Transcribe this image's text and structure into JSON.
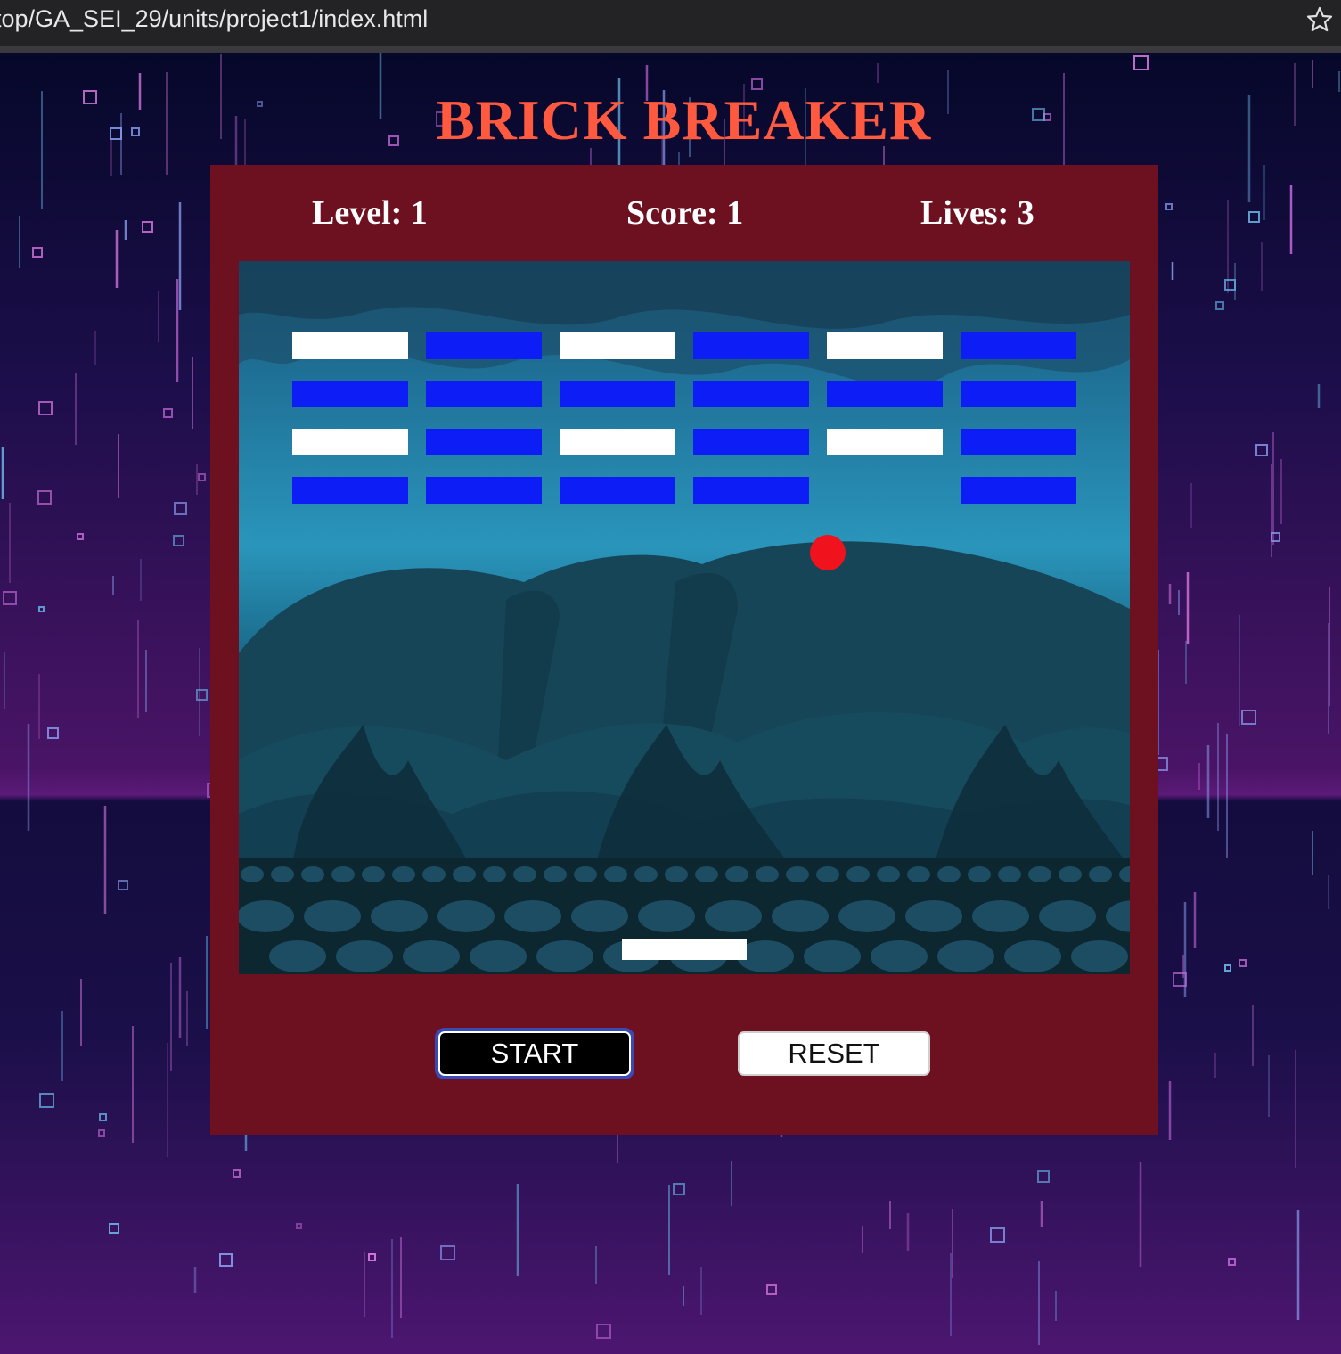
{
  "browser": {
    "url": "top/GA_SEI_29/units/project1/index.html",
    "bookmark_icon": "star-icon"
  },
  "game": {
    "title": "BRICK BREAKER",
    "level_text": "Level: 1",
    "score_text": "Score: 1",
    "lives_text": "Lives: 3",
    "level": 1,
    "score": 1,
    "lives": 3,
    "bricks": [
      [
        "white",
        "blue",
        "white",
        "blue",
        "white",
        "blue"
      ],
      [
        "blue",
        "blue",
        "blue",
        "blue",
        "blue",
        "blue"
      ],
      [
        "white",
        "blue",
        "white",
        "blue",
        "white",
        "blue"
      ],
      [
        "blue",
        "blue",
        "blue",
        "blue",
        "none",
        "blue"
      ]
    ],
    "colors": {
      "title": "#ff5a40",
      "panel": "#6d1020",
      "brick_blue": "#0c1ef5",
      "brick_white": "#ffffff",
      "ball": "#f0121c",
      "paddle": "#ffffff"
    }
  },
  "controls": {
    "start_label": "START",
    "reset_label": "RESET"
  }
}
